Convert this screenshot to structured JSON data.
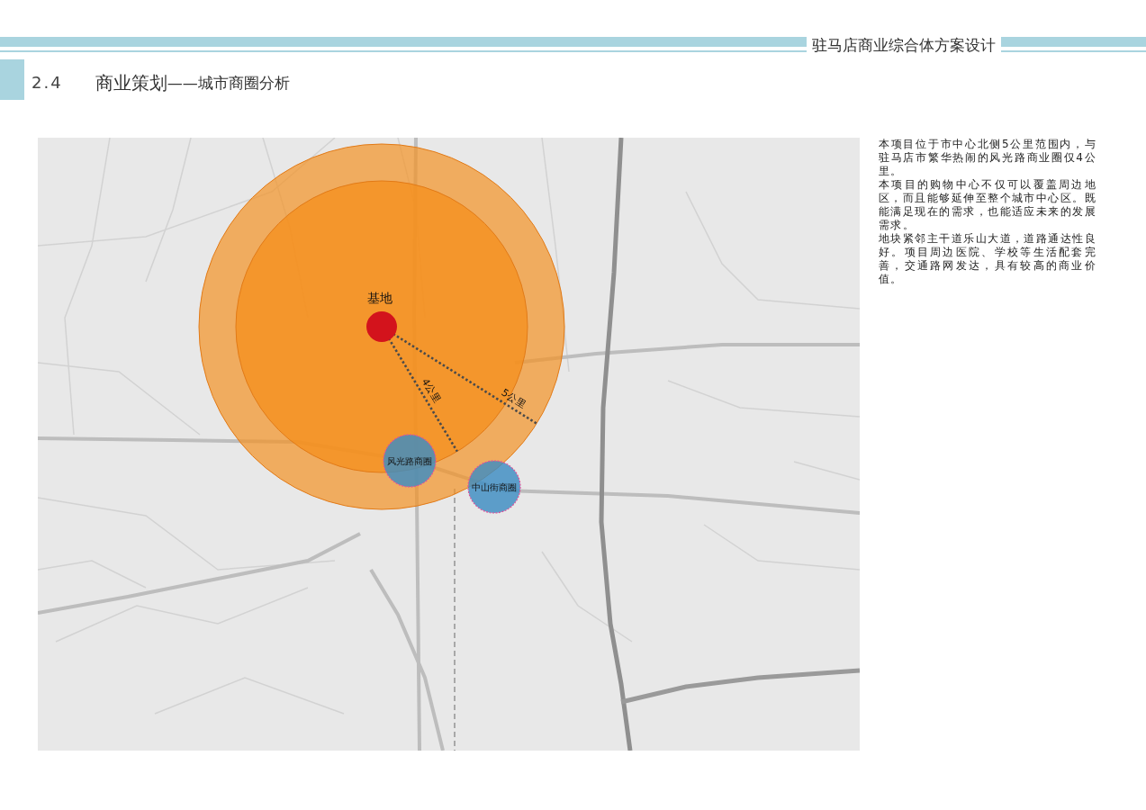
{
  "header": {
    "title": "驻马店商业综合体方案设计"
  },
  "section": {
    "number": "2.4",
    "title": "商业策划",
    "subtitle": "——城市商圈分析"
  },
  "map": {
    "site": {
      "label": "基地"
    },
    "rings": [
      {
        "label": "4公里"
      },
      {
        "label": "5公里"
      }
    ],
    "districts": [
      {
        "label": "风光路商圈"
      },
      {
        "label": "中山街商圈"
      }
    ]
  },
  "description": [
    "本项目位于市中心北侧5公里范围内，与驻马店市繁华热闹的风光路商业圈仅4公里。",
    "本项目的购物中心不仅可以覆盖周边地区，而且能够延伸至整个城市中心区。既能满足现在的需求，也能适应未来的发展需求。",
    "地块紧邻主干道乐山大道，道路通达性良好。项目周边医院、学校等生活配套完善，交通路网发达，具有较高的商业价值。"
  ]
}
